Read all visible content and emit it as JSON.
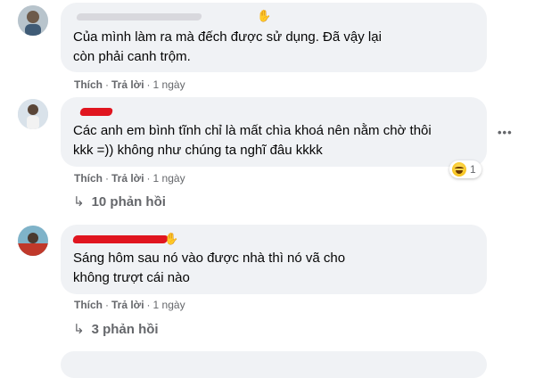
{
  "comments": [
    {
      "text": "Của mình làm ra mà đếch được sử dụng. Đã vậy lại còn phải canh trộm.",
      "actions": {
        "like": "Thích",
        "reply": "Trả lời",
        "time": "1 ngày"
      }
    },
    {
      "text": "Các anh em bình tĩnh chỉ là mất chìa khoá nên nằm chờ thôi kkk =)) không như chúng ta nghĩ đâu kkkk",
      "actions": {
        "like": "Thích",
        "reply": "Trả lời",
        "time": "1 ngày"
      },
      "reaction": {
        "icon": "haha-emoji-icon",
        "count": "1"
      },
      "replies": "10 phản hồi",
      "more_icon": "more-options-icon"
    },
    {
      "text": "Sáng hôm sau nó vào được nhà thì nó vã cho không trượt cái nào",
      "actions": {
        "like": "Thích",
        "reply": "Trả lời",
        "time": "1 ngày"
      },
      "replies": "3 phản hồi"
    }
  ],
  "separator": "·",
  "reply_arrow": "↳",
  "colors": {
    "bubble": "#f0f2f5",
    "meta": "#65676b",
    "redaction": "#e0151f",
    "reaction": "#f5b800"
  }
}
